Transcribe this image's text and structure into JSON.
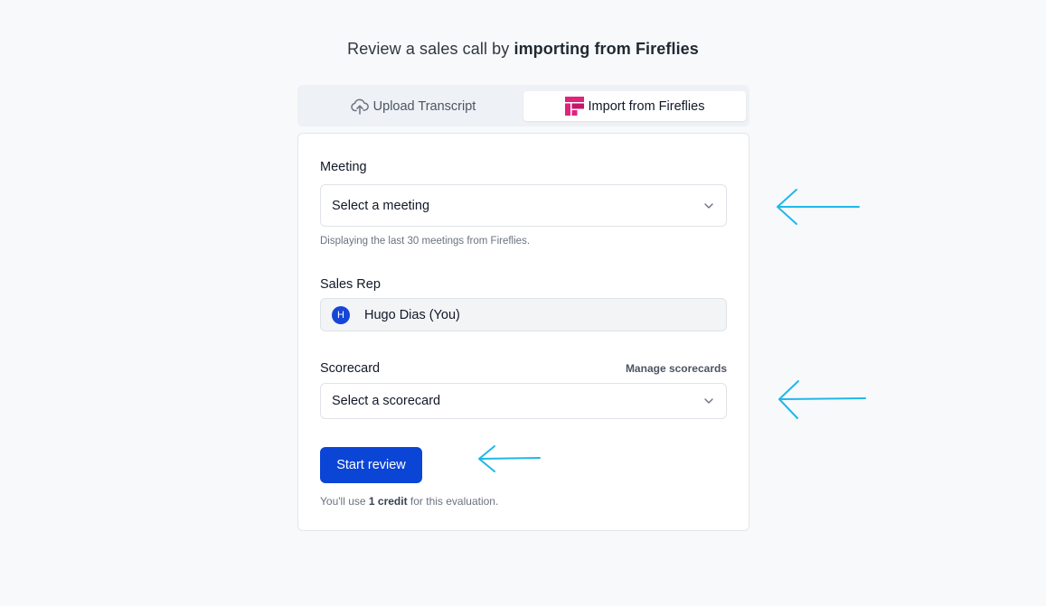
{
  "header": {
    "title_prefix": "Review a sales call by ",
    "title_bold": "importing from Fireflies"
  },
  "tabs": [
    {
      "label": "Upload Transcript",
      "icon": "cloud-upload-icon",
      "active": false
    },
    {
      "label": "Import from Fireflies",
      "icon": "fireflies-logo-icon",
      "active": true
    }
  ],
  "form": {
    "meeting": {
      "label": "Meeting",
      "placeholder": "Select a meeting",
      "helper": "Displaying the last 30 meetings from Fireflies."
    },
    "sales_rep": {
      "label": "Sales Rep",
      "avatar_initial": "H",
      "value": "Hugo Dias (You)"
    },
    "scorecard": {
      "label": "Scorecard",
      "manage_link": "Manage scorecards",
      "placeholder": "Select a scorecard"
    },
    "submit_label": "Start review",
    "credit_note": {
      "prefix": "You'll use ",
      "bold": "1 credit",
      "suffix": " for this evaluation."
    }
  },
  "colors": {
    "primary": "#0b45d6",
    "annotation_arrow": "#1fb8ea",
    "fireflies_logo": "#e0237c"
  }
}
